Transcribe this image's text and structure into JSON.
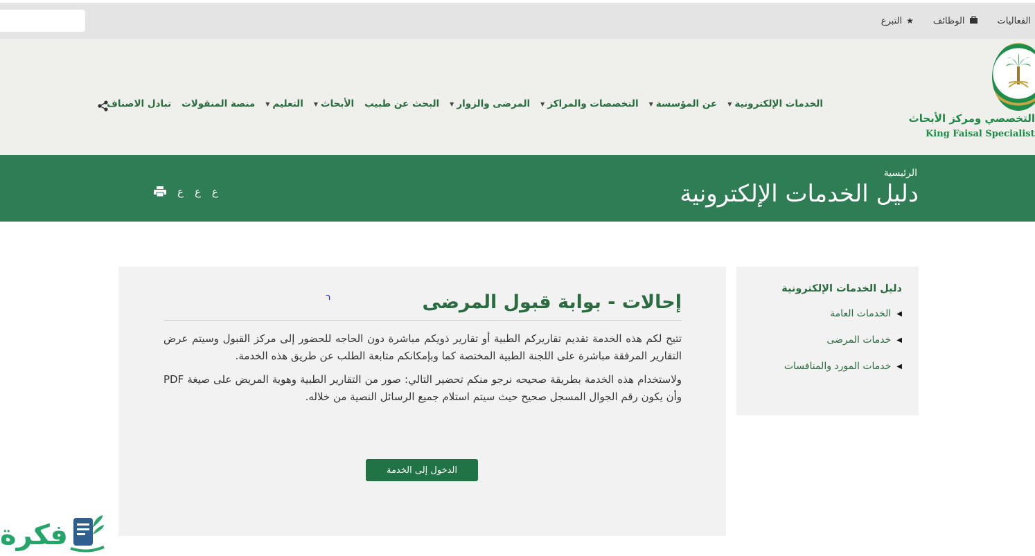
{
  "topbar": {
    "search_value": "",
    "links": [
      {
        "label": "الفعاليات",
        "icon": ""
      },
      {
        "label": "الوظائف",
        "icon": "briefcase-icon"
      },
      {
        "label": "التبرع",
        "icon": "star-icon"
      }
    ]
  },
  "logo": {
    "arabic": "التخصصي ومركز الأبحاث",
    "english": "King Faisal Specialist Hosp"
  },
  "nav": {
    "items": [
      {
        "label": "الخدمات الإلكترونية",
        "dropdown": true
      },
      {
        "label": "عن المؤسسة",
        "dropdown": true
      },
      {
        "label": "التخصصات والمراكز",
        "dropdown": true
      },
      {
        "label": "المرضى والزوار",
        "dropdown": true
      },
      {
        "label": "البحث عن طبيب",
        "dropdown": false
      },
      {
        "label": "الأبحاث",
        "dropdown": true
      },
      {
        "label": "التعليم",
        "dropdown": true
      },
      {
        "label": "منصة المنقولات",
        "dropdown": false
      },
      {
        "label": "تبادل الاصناف",
        "dropdown": false
      }
    ]
  },
  "banner": {
    "breadcrumb": "الرئيسية",
    "title": "دليل الخدمات الإلكترونية",
    "tools": [
      "ع",
      "ع",
      "ع"
    ]
  },
  "sidebar": {
    "title": "دليل الخدمات الإلكترونية",
    "items": [
      "الخدمات العامة",
      "خدمات المرضى",
      "خدمات المورد والمنافسات"
    ]
  },
  "content": {
    "title": "إحالات - بوابة قبول المرضى",
    "stray_mark": "ר",
    "paragraphs": [
      "تتيح لكم هذه الخدمة تقديم تقاريركم الطبية أو تقارير ذويكم مباشرة دون الحاجه للحضور إلى مركز القبول وسيتم عرض التقارير المرفقة مباشرة على اللجنة الطبية المختصة كما وبإمكانكم متابعة الطلب عن طريق هذه الخدمة.",
      "ولاستخدام هذه الخدمة بطريقة صحيحه نرجو منكم تحضير التالي: صور من التقارير الطبية وهوية المريض على صيغة PDF  وأن يكون رقم الجوال المسجل صحيح حيث سيتم استلام جميع الرسائل النصية من خلاله."
    ],
    "button_label": "الدخول إلى الخدمة"
  },
  "watermark": {
    "text": "فكرة"
  },
  "colors": {
    "brand_green": "#2e7d55",
    "text_green": "#2b6b40",
    "button_green": "#217346",
    "card_bg": "#f2f2f2"
  }
}
